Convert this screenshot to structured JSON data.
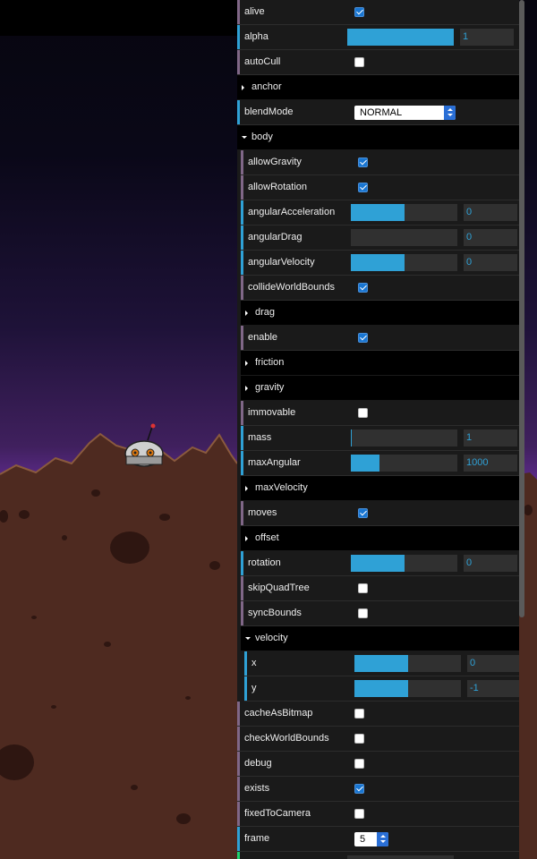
{
  "scene": {
    "sky_top": "#060512",
    "sky_horizon": "#5b2a8c",
    "ground": "#5a3023",
    "ground_dark": "#3b1d16"
  },
  "inspector": {
    "rows": [
      {
        "label": "alive",
        "kind": "bool",
        "checked": true,
        "level": 0
      },
      {
        "label": "alpha",
        "kind": "number",
        "value": "1",
        "fill": 1.0,
        "level": 0
      },
      {
        "label": "autoCull",
        "kind": "bool",
        "checked": false,
        "level": 0
      },
      {
        "label": "anchor",
        "kind": "folder",
        "open": false,
        "level": 0
      },
      {
        "label": "blendMode",
        "kind": "select",
        "value": "NORMAL",
        "level": 0
      },
      {
        "label": "body",
        "kind": "folder",
        "open": true,
        "level": 0
      },
      {
        "label": "allowGravity",
        "kind": "bool",
        "checked": true,
        "level": 1
      },
      {
        "label": "allowRotation",
        "kind": "bool",
        "checked": true,
        "level": 1
      },
      {
        "label": "angularAcceleration",
        "kind": "number",
        "value": "0",
        "fill": 0.5,
        "level": 1
      },
      {
        "label": "angularDrag",
        "kind": "number",
        "value": "0",
        "fill": 0.0,
        "level": 1
      },
      {
        "label": "angularVelocity",
        "kind": "number",
        "value": "0",
        "fill": 0.5,
        "level": 1
      },
      {
        "label": "collideWorldBounds",
        "kind": "bool",
        "checked": true,
        "level": 1
      },
      {
        "label": "drag",
        "kind": "folder",
        "open": false,
        "level": 1
      },
      {
        "label": "enable",
        "kind": "bool",
        "checked": true,
        "level": 1
      },
      {
        "label": "friction",
        "kind": "folder",
        "open": false,
        "level": 1
      },
      {
        "label": "gravity",
        "kind": "folder",
        "open": false,
        "level": 1
      },
      {
        "label": "immovable",
        "kind": "bool",
        "checked": false,
        "level": 1
      },
      {
        "label": "mass",
        "kind": "number",
        "value": "1",
        "fill": 0.01,
        "level": 1
      },
      {
        "label": "maxAngular",
        "kind": "number",
        "value": "1000",
        "fill": 0.27,
        "level": 1
      },
      {
        "label": "maxVelocity",
        "kind": "folder",
        "open": false,
        "level": 1
      },
      {
        "label": "moves",
        "kind": "bool",
        "checked": true,
        "level": 1
      },
      {
        "label": "offset",
        "kind": "folder",
        "open": false,
        "level": 1
      },
      {
        "label": "rotation",
        "kind": "number",
        "value": "0",
        "fill": 0.5,
        "level": 1
      },
      {
        "label": "skipQuadTree",
        "kind": "bool",
        "checked": false,
        "level": 1
      },
      {
        "label": "syncBounds",
        "kind": "bool",
        "checked": false,
        "level": 1
      },
      {
        "label": "velocity",
        "kind": "folder",
        "open": true,
        "level": 1
      },
      {
        "label": "x",
        "kind": "number",
        "value": "0",
        "fill": 0.5,
        "level": 2
      },
      {
        "label": "y",
        "kind": "number",
        "value": "-1",
        "fill": 0.5,
        "level": 2
      },
      {
        "label": "cacheAsBitmap",
        "kind": "bool",
        "checked": false,
        "level": 0
      },
      {
        "label": "checkWorldBounds",
        "kind": "bool",
        "checked": false,
        "level": 0
      },
      {
        "label": "debug",
        "kind": "bool",
        "checked": false,
        "level": 0
      },
      {
        "label": "exists",
        "kind": "bool",
        "checked": true,
        "level": 0
      },
      {
        "label": "fixedToCamera",
        "kind": "bool",
        "checked": false,
        "level": 0
      },
      {
        "label": "frame",
        "kind": "select-small",
        "value": "5",
        "level": 0
      },
      {
        "label": "",
        "kind": "partial",
        "level": 0
      }
    ]
  }
}
